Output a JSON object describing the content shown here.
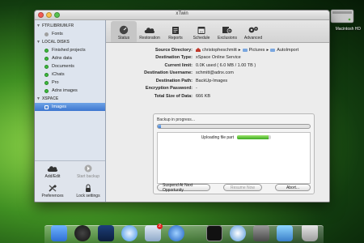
{
  "window": {
    "title": "xTwin"
  },
  "sidebar": {
    "groups": [
      {
        "label": "FTP.LIBRIUM.FR",
        "items": [
          {
            "label": "Fonts",
            "dot": "gray"
          }
        ]
      },
      {
        "label": "LOCAL DISKS",
        "items": [
          {
            "label": "Finished projects",
            "dot": "green"
          },
          {
            "label": "Adnx data",
            "dot": "green"
          },
          {
            "label": "Documents",
            "dot": "green"
          },
          {
            "label": "iChats",
            "dot": "green"
          },
          {
            "label": "Pro",
            "dot": "green"
          },
          {
            "label": "Adnx images",
            "dot": "green"
          }
        ]
      },
      {
        "label": "XSPACE",
        "items": [
          {
            "label": "Images",
            "selected": true
          }
        ]
      }
    ],
    "actions": {
      "add_edit": "Add/Edit",
      "start_backup": "Start backup",
      "preferences": "Preferences",
      "lock_settings": "Lock settings"
    }
  },
  "toolbar": {
    "items": [
      {
        "label": "Status",
        "icon": "gauge-icon",
        "active": true
      },
      {
        "label": "Restoration",
        "icon": "cloud-restore-icon"
      },
      {
        "label": "Reports",
        "icon": "reports-icon"
      },
      {
        "label": "Schedule",
        "icon": "calendar-icon"
      },
      {
        "label": "Exclusions",
        "icon": "exclusions-icon"
      },
      {
        "label": "Advanced",
        "icon": "advanced-gears-icon"
      }
    ]
  },
  "info": {
    "source_directory": {
      "label": "Source Directory:",
      "path": [
        "christopheschmitt",
        "Pictures",
        "AutoImport"
      ]
    },
    "destination_type": {
      "label": "Destination Type:",
      "value": "xSpace Online Service"
    },
    "current_limit": {
      "label": "Current limit:",
      "value": "0.0K used ( 6.0 MB / 1.00 TB )"
    },
    "destination_username": {
      "label": "Destination Username:",
      "value": "schmitt@adnx.com"
    },
    "destination_path": {
      "label": "Destination Path:",
      "value": "BackUp-Images"
    },
    "encryption_password": {
      "label": "Encryption Password:",
      "value": "-"
    },
    "total_size": {
      "label": "Total Size of Data:",
      "value": "666 KB"
    }
  },
  "progress": {
    "status": "Backup in progress...",
    "overall_fraction": 0.02,
    "upload_label": "Uploading file part",
    "upload_fraction": 0.92,
    "buttons": {
      "suspend": "Suspend At Next Opportunity",
      "resume": "Resume Now",
      "abort": "Abort..."
    }
  },
  "desktop": {
    "drive_label": "Macintosh HD"
  },
  "dock": {
    "items": [
      "finder-icon",
      "dashboard-icon",
      "expose-icon",
      "safari-icon",
      "mail-icon",
      "itunes-icon",
      "terminal-icon",
      "network-icon",
      "utilities-icon",
      "downloads-icon",
      "trash-icon"
    ],
    "mail_badge": "2"
  },
  "colors": {
    "accent": "#3d76cf",
    "status_green": "#3dba3d",
    "upload_green": "#3aaa1e"
  }
}
